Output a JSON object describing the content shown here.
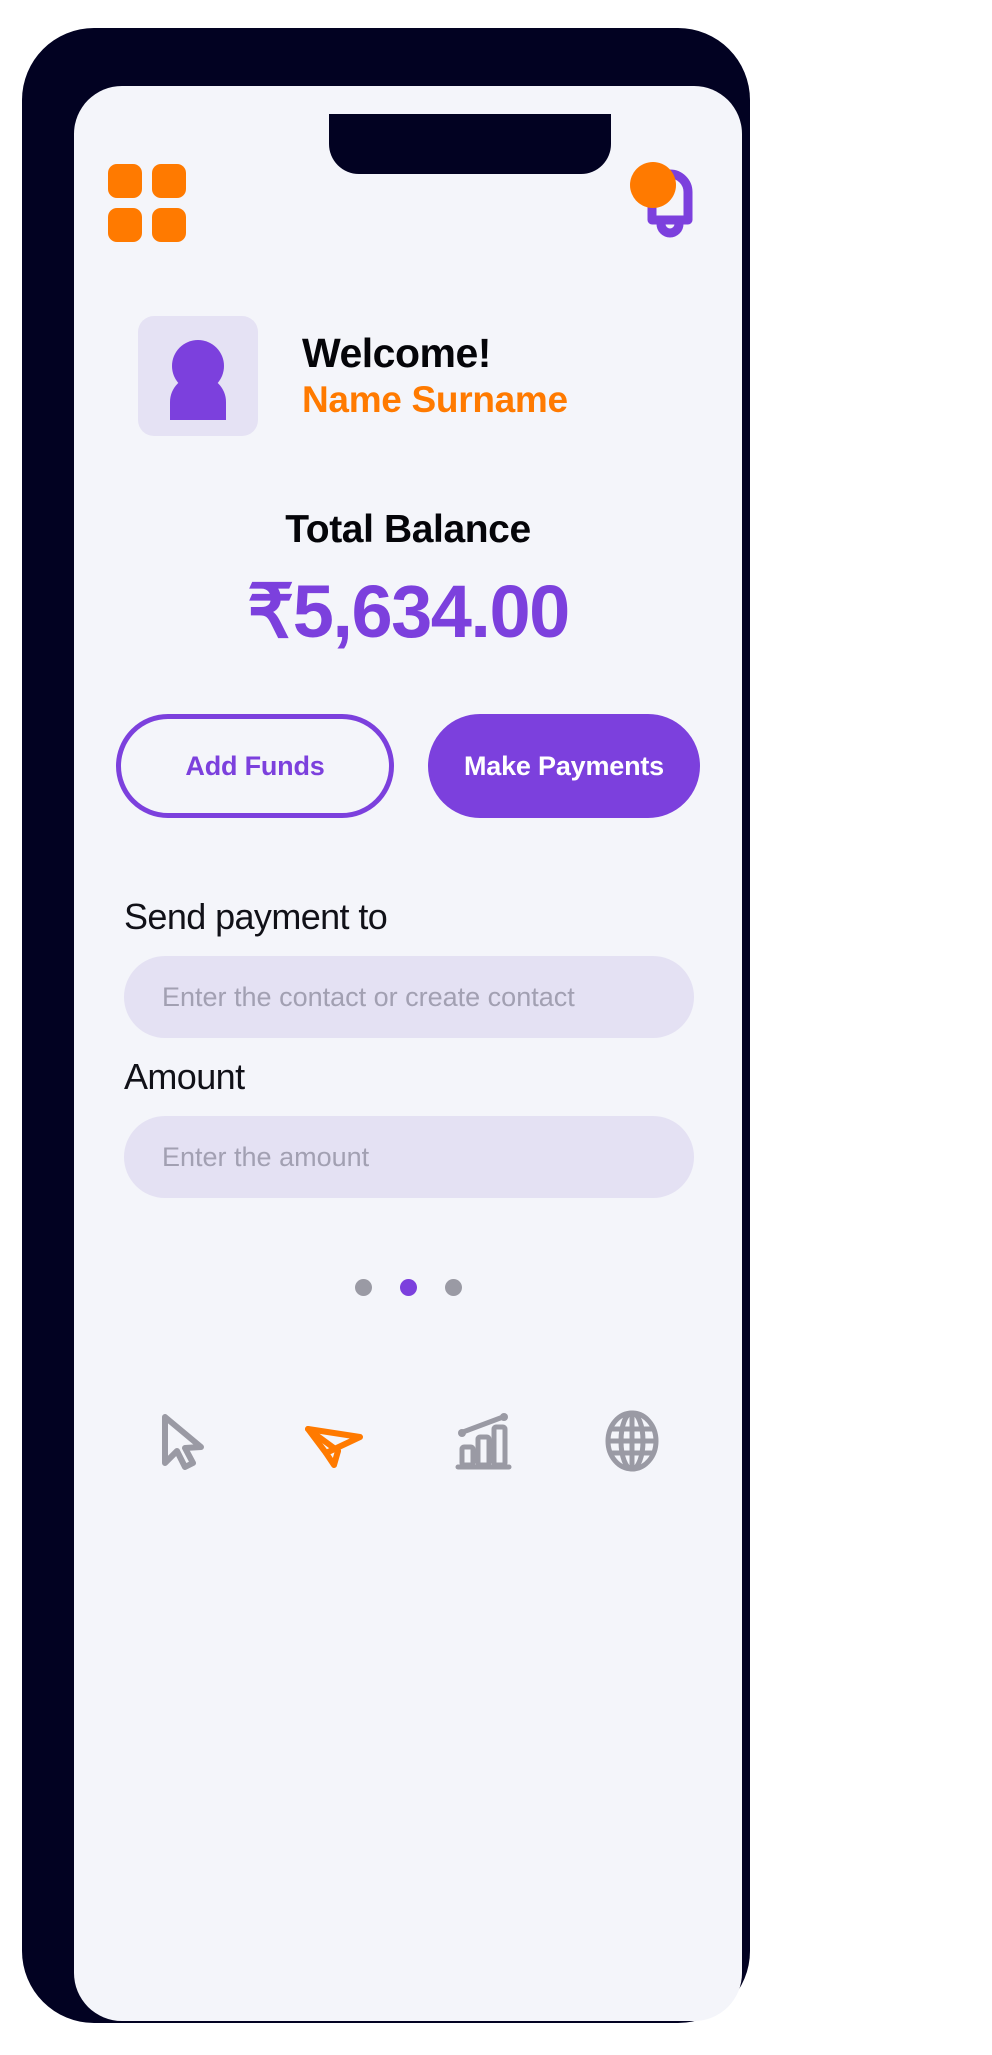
{
  "app": {
    "background_color": "#ffffff",
    "frame_color": "#020222",
    "screen_color": "#f4f5fa",
    "accent_purple": "#7c40dd",
    "accent_orange": "#ff7a00"
  },
  "topbar": {
    "menu_icon": "grid-icon",
    "notification_icon": "bell-icon",
    "notification_badge": true
  },
  "welcome": {
    "avatar_icon": "person-avatar-icon",
    "greeting": "Welcome!",
    "user_name": "Name Surname"
  },
  "balance": {
    "label": "Total Balance",
    "amount": "₹5,634.00",
    "currency_symbol": "₹",
    "value": "5,634.00"
  },
  "actions": {
    "add_funds_label": "Add Funds",
    "make_payments_label": "Make Payments"
  },
  "form": {
    "recipient": {
      "label": "Send payment to",
      "placeholder": "Enter the contact or create contact",
      "value": ""
    },
    "amount": {
      "label": "Amount",
      "placeholder": "Enter the amount",
      "value": ""
    }
  },
  "pager": {
    "total": 3,
    "active_index": 1
  },
  "bottom_nav": {
    "items": [
      {
        "icon": "cursor-pointer-icon",
        "active": false,
        "color": "#9a9aa4"
      },
      {
        "icon": "paper-plane-icon",
        "active": true,
        "color": "#ff7a00"
      },
      {
        "icon": "bar-chart-icon",
        "active": false,
        "color": "#9a9aa4"
      },
      {
        "icon": "globe-icon",
        "active": false,
        "color": "#9a9aa4"
      }
    ]
  }
}
